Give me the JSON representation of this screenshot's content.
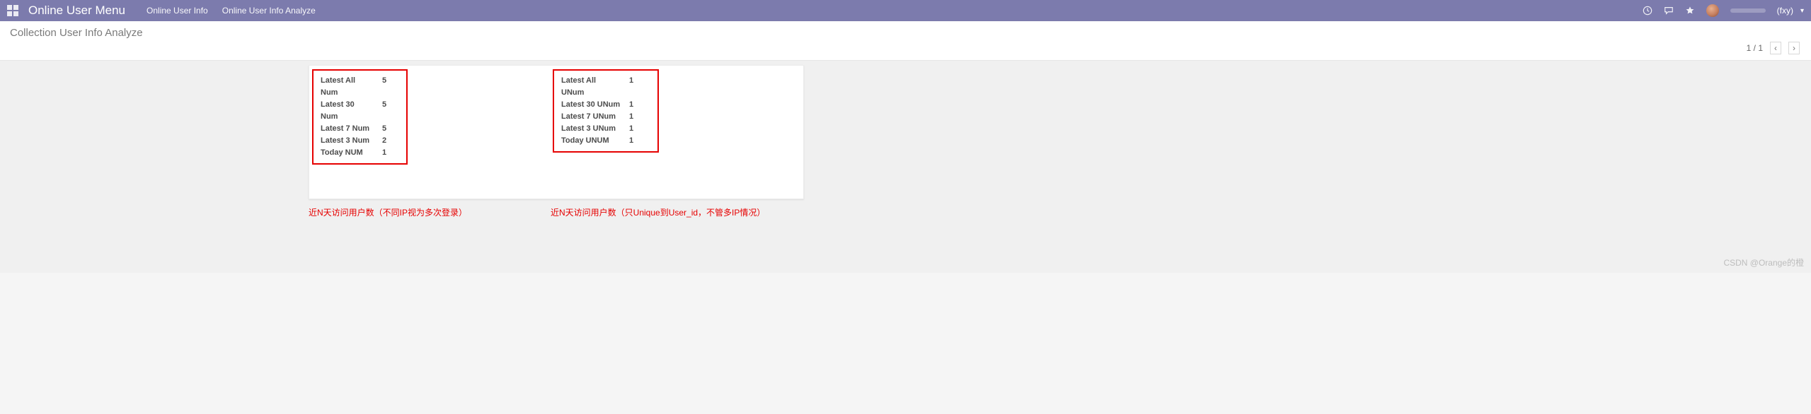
{
  "nav": {
    "title": "Online User Menu",
    "links": [
      "Online User Info",
      "Online User Info Analyze"
    ],
    "user_name": "(fxy)"
  },
  "breadcrumb": {
    "title": "Collection User Info Analyze"
  },
  "pager": {
    "text": "1 / 1"
  },
  "leftBox": {
    "rows": [
      {
        "label": "Latest All Num",
        "value": "5"
      },
      {
        "label": "Latest 30 Num",
        "value": "5"
      },
      {
        "label": "Latest 7 Num",
        "value": "5"
      },
      {
        "label": "Latest 3 Num",
        "value": "2"
      },
      {
        "label": "Today NUM",
        "value": "1"
      }
    ]
  },
  "rightBox": {
    "rows": [
      {
        "label": "Latest All UNum",
        "value": "1"
      },
      {
        "label": "Latest 30 UNum",
        "value": "1"
      },
      {
        "label": "Latest 7 UNum",
        "value": "1"
      },
      {
        "label": "Latest 3 UNum",
        "value": "1"
      },
      {
        "label": "Today UNUM",
        "value": "1"
      }
    ]
  },
  "annotations": {
    "left": "近N天访问用户数（不同IP视为多次登录）",
    "right": "近N天访问用户数（只Unique到User_id，不管多IP情况）"
  },
  "watermark": "CSDN @Orange的橙"
}
